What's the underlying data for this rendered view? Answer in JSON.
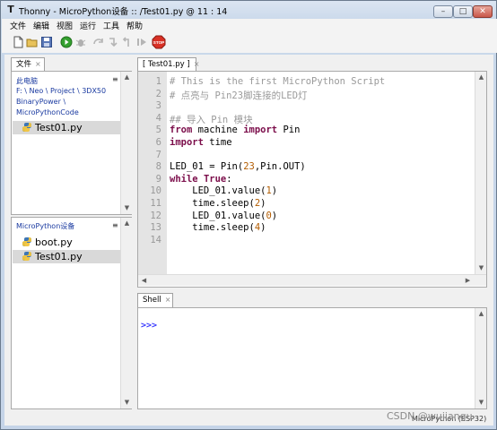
{
  "window": {
    "title": "Thonny  -  MicroPython设备 :: /Test01.py  @  11 : 14",
    "app_icon": "thonny-icon",
    "buttons": {
      "minimize": "–",
      "maximize": "□",
      "close": "✕"
    }
  },
  "menubar": {
    "items": [
      "文件",
      "编辑",
      "视图",
      "运行",
      "工具",
      "帮助"
    ]
  },
  "toolbar": {
    "icons": [
      "new-file-icon",
      "open-file-icon",
      "save-icon",
      "run-icon",
      "debug-icon",
      "step-over-icon",
      "step-into-icon",
      "step-out-icon",
      "resume-icon",
      "stop-icon"
    ],
    "stop_label": "STOP"
  },
  "files_panel": {
    "tab_label": "文件",
    "tab_close": "×",
    "computer": {
      "header": "此电脑",
      "menu_glyph": "≡",
      "path_lines": [
        "F: \\ Neo \\ Project \\ 3DX50",
        "BinaryPower \\",
        "MicroPythonCode"
      ],
      "files": [
        {
          "name": "Test01.py",
          "selected": true
        }
      ]
    },
    "device": {
      "header": "MicroPython设备",
      "menu_glyph": "≡",
      "files": [
        {
          "name": "boot.py",
          "selected": false
        },
        {
          "name": "Test01.py",
          "selected": true
        }
      ]
    }
  },
  "editor": {
    "tab_label": "[ Test01.py ]",
    "tab_close": "×",
    "line_numbers": [
      "1",
      "2",
      "3",
      "4",
      "5",
      "6",
      "7",
      "8",
      "9",
      "10",
      "11",
      "12",
      "13",
      "14"
    ],
    "lines": [
      [
        {
          "t": "# This is the first MicroPython Script",
          "c": "cm"
        }
      ],
      [
        {
          "t": "# 点亮与 Pin23脚连接的LED灯",
          "c": "cm"
        }
      ],
      [],
      [
        {
          "t": "## 导入 Pin 模块",
          "c": "cm"
        }
      ],
      [
        {
          "t": "from",
          "c": "kw"
        },
        {
          "t": " machine ",
          "c": ""
        },
        {
          "t": "import",
          "c": "kw"
        },
        {
          "t": " Pin",
          "c": ""
        }
      ],
      [
        {
          "t": "import",
          "c": "kw"
        },
        {
          "t": " time",
          "c": ""
        }
      ],
      [],
      [
        {
          "t": "LED_01 = Pin(",
          "c": ""
        },
        {
          "t": "23",
          "c": "num"
        },
        {
          "t": ",Pin.OUT)",
          "c": ""
        }
      ],
      [
        {
          "t": "while",
          "c": "kw"
        },
        {
          "t": " ",
          "c": ""
        },
        {
          "t": "True",
          "c": "kw"
        },
        {
          "t": ":",
          "c": ""
        }
      ],
      [
        {
          "t": "    LED_01.value(",
          "c": ""
        },
        {
          "t": "1",
          "c": "num"
        },
        {
          "t": ")",
          "c": ""
        }
      ],
      [
        {
          "t": "    time.sleep(",
          "c": ""
        },
        {
          "t": "2",
          "c": "num"
        },
        {
          "t": ")",
          "c": ""
        }
      ],
      [
        {
          "t": "    LED_01.value(",
          "c": ""
        },
        {
          "t": "0",
          "c": "num"
        },
        {
          "t": ")",
          "c": ""
        }
      ],
      [
        {
          "t": "    time.sleep(",
          "c": ""
        },
        {
          "t": "4",
          "c": "num"
        },
        {
          "t": ")",
          "c": ""
        }
      ],
      []
    ]
  },
  "shell": {
    "tab_label": "Shell",
    "tab_close": "×",
    "prompt": ">>>"
  },
  "statusbar": {
    "text": "MicroPython (ESP32)"
  },
  "watermark": {
    "text": "CSDN @wujiangu"
  },
  "colors": {
    "keyword": "#7b0d4a",
    "comment": "#9a9a9a",
    "number": "#b35c00",
    "prompt": "#3c3cff",
    "path_text": "#1a3aa0"
  }
}
